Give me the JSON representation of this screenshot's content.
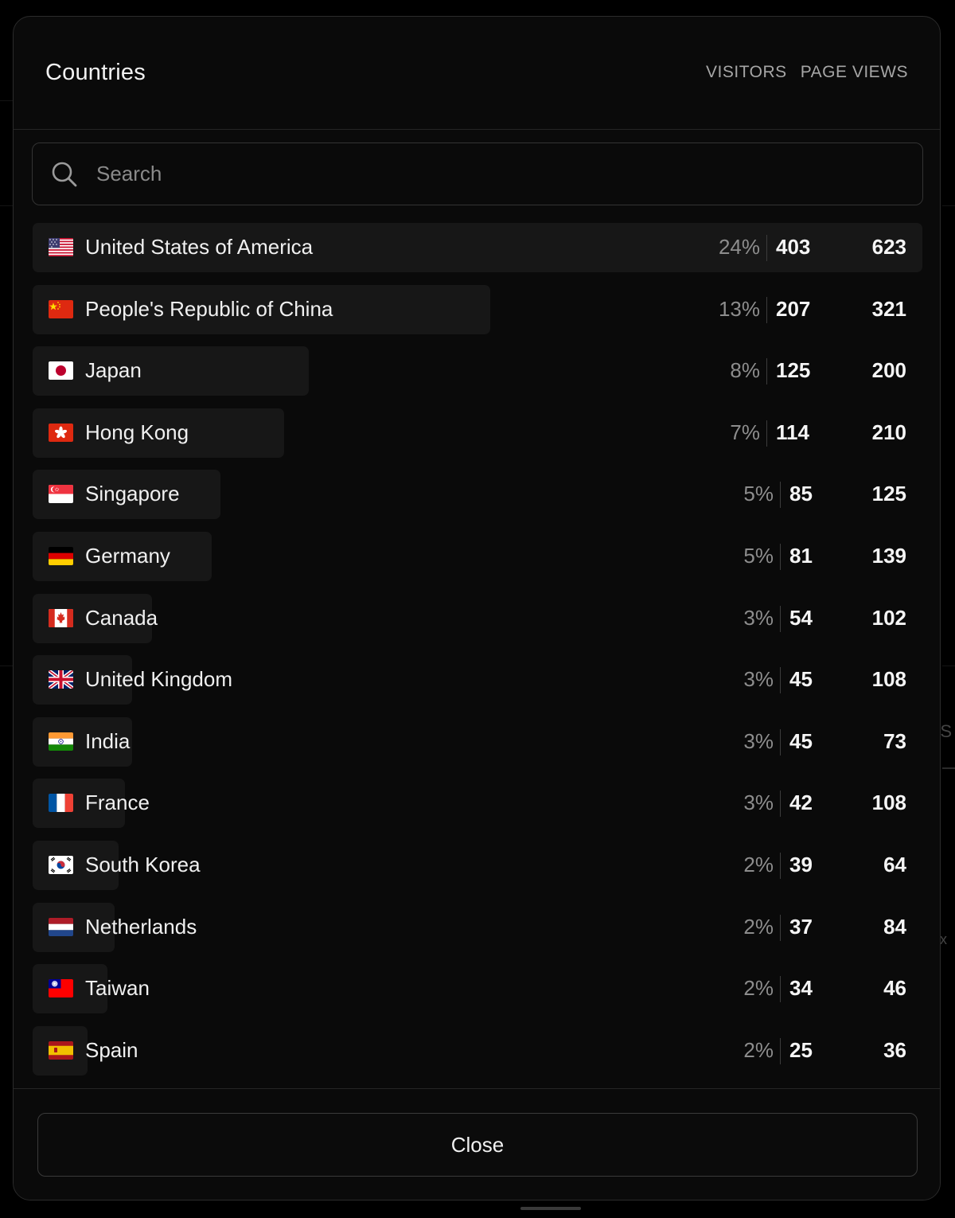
{
  "modal": {
    "title": "Countries",
    "columns": {
      "visitors": "VISITORS",
      "page_views": "PAGE VIEWS"
    },
    "search": {
      "placeholder": "Search",
      "value": ""
    },
    "close_label": "Close"
  },
  "background": {
    "edge_letter_s": "S",
    "edge_letter_x": "x"
  },
  "countries": [
    {
      "name": "United States of America",
      "flag": "us-flag-icon",
      "share": "24%",
      "share_fraction": 1.0,
      "visitors": "403",
      "page_views": "623"
    },
    {
      "name": "People's Republic of China",
      "flag": "cn-flag-icon",
      "share": "13%",
      "share_fraction": 0.514,
      "visitors": "207",
      "page_views": "321"
    },
    {
      "name": "Japan",
      "flag": "jp-flag-icon",
      "share": "8%",
      "share_fraction": 0.31,
      "visitors": "125",
      "page_views": "200"
    },
    {
      "name": "Hong Kong",
      "flag": "hk-flag-icon",
      "share": "7%",
      "share_fraction": 0.283,
      "visitors": "114",
      "page_views": "210"
    },
    {
      "name": "Singapore",
      "flag": "sg-flag-icon",
      "share": "5%",
      "share_fraction": 0.211,
      "visitors": "85",
      "page_views": "125"
    },
    {
      "name": "Germany",
      "flag": "de-flag-icon",
      "share": "5%",
      "share_fraction": 0.201,
      "visitors": "81",
      "page_views": "139"
    },
    {
      "name": "Canada",
      "flag": "ca-flag-icon",
      "share": "3%",
      "share_fraction": 0.134,
      "visitors": "54",
      "page_views": "102"
    },
    {
      "name": "United Kingdom",
      "flag": "gb-flag-icon",
      "share": "3%",
      "share_fraction": 0.112,
      "visitors": "45",
      "page_views": "108"
    },
    {
      "name": "India",
      "flag": "in-flag-icon",
      "share": "3%",
      "share_fraction": 0.112,
      "visitors": "45",
      "page_views": "73"
    },
    {
      "name": "France",
      "flag": "fr-flag-icon",
      "share": "3%",
      "share_fraction": 0.104,
      "visitors": "42",
      "page_views": "108"
    },
    {
      "name": "South Korea",
      "flag": "kr-flag-icon",
      "share": "2%",
      "share_fraction": 0.097,
      "visitors": "39",
      "page_views": "64"
    },
    {
      "name": "Netherlands",
      "flag": "nl-flag-icon",
      "share": "2%",
      "share_fraction": 0.092,
      "visitors": "37",
      "page_views": "84"
    },
    {
      "name": "Taiwan",
      "flag": "tw-flag-icon",
      "share": "2%",
      "share_fraction": 0.084,
      "visitors": "34",
      "page_views": "46"
    },
    {
      "name": "Spain",
      "flag": "es-flag-icon",
      "share": "2%",
      "share_fraction": 0.062,
      "visitors": "25",
      "page_views": "36"
    }
  ],
  "colors": {
    "background": "#000000",
    "modal": "#0a0a0a",
    "bar": "#171717",
    "border": "#2b2b2b",
    "muted_text": "#8d8d8d",
    "text": "#f0f0f0"
  }
}
